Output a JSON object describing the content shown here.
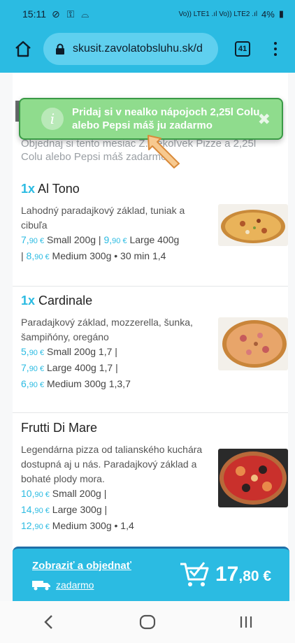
{
  "status_bar": {
    "time": "15:11",
    "battery": "4%",
    "signal_text": "Vo)) LTE1 .ıl Vo)) LTE2 .ıl"
  },
  "browser": {
    "url": "skusit.zavolatobsluhu.sk/d",
    "tab_count": "41"
  },
  "promo_text": "Objednaj si tento mesiac Z... ekoľvek Pizze a 2,25l Colu alebo Pepsi máš zadarmo",
  "toast": {
    "message": "Pridaj si v nealko nápojoch 2,25l Colu alebo Pepsi máš ju zadarmo",
    "close": "✖"
  },
  "items": [
    {
      "qty": "1x",
      "name": "Al Tono",
      "description": "Lahodný paradajkový základ, tuniak a cibuľa",
      "lines": [
        {
          "p1": "7,",
          "c1": "90 €",
          "t1": " Small 200g | ",
          "p2": "9,",
          "c2": "90 €",
          "t2": " Large 400g"
        },
        {
          "p0": "| ",
          "p1": "8,",
          "c1": "90 €",
          "t1": " Medium 300g • 30 min 1,4"
        }
      ]
    },
    {
      "qty": "1x",
      "name": "Cardinale",
      "description": "Paradajkový základ, mozzerella, šunka, šampiňóny, oregáno",
      "lines": [
        {
          "p1": "5,",
          "c1": "90 €",
          "t1": " Small 200g 1,7 |"
        },
        {
          "p1": "7,",
          "c1": "90 €",
          "t1": " Large 400g 1,7 |"
        },
        {
          "p1": "6,",
          "c1": "90 €",
          "t1": " Medium 300g 1,3,7"
        }
      ]
    },
    {
      "qty": "",
      "name": "Frutti Di Mare",
      "description": "Legendárna pizza od talianského kuchára dostupná aj u nás. Paradajkový základ a bohaté plody mora.",
      "lines": [
        {
          "p1": "10,",
          "c1": "90 €",
          "t1": " Small 200g |"
        },
        {
          "p1": "14,",
          "c1": "90 €",
          "t1": " Large 300g |"
        },
        {
          "p1": "12,",
          "c1": "90 €",
          "t1": " Medium 300g • 1,4"
        }
      ]
    }
  ],
  "order_bar": {
    "link": "Zobraziť a objednať",
    "delivery": "zadarmo",
    "total_main": "17",
    "total_cents": ",80 €"
  },
  "colors": {
    "accent": "#2bbbe2",
    "toast_green": "#8fdc8d",
    "toast_border": "#3a9a46"
  }
}
